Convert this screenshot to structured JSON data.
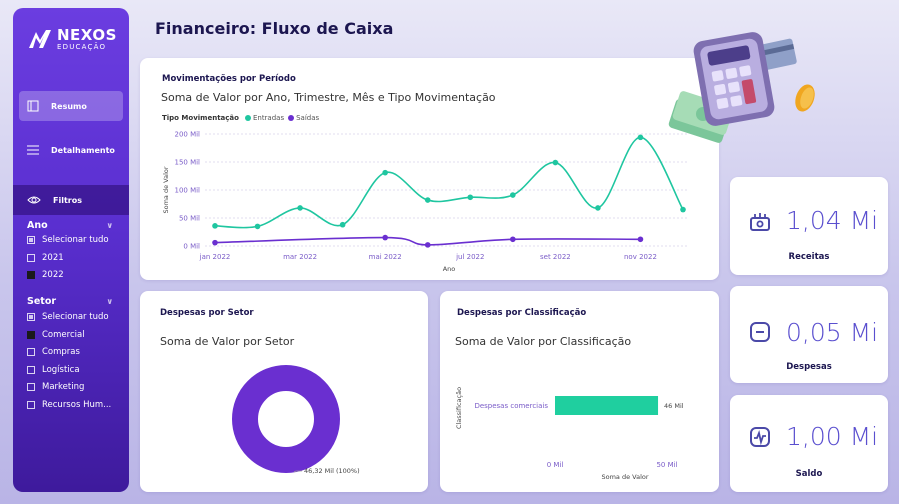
{
  "brand": {
    "name": "NEXOS",
    "tagline": "EDUCAÇÃO"
  },
  "sidebar": {
    "nav": [
      {
        "label": "Resumo",
        "icon": "page-icon",
        "active": true
      },
      {
        "label": "Detalhamento",
        "icon": "menu-icon",
        "active": false
      }
    ],
    "filters_label": "Filtros",
    "slicers": {
      "ano": {
        "title": "Ano",
        "options": [
          {
            "label": "Selecionar tudo",
            "state": "partial"
          },
          {
            "label": "2021",
            "state": "unchecked"
          },
          {
            "label": "2022",
            "state": "checked"
          }
        ]
      },
      "setor": {
        "title": "Setor",
        "options": [
          {
            "label": "Selecionar tudo",
            "state": "partial"
          },
          {
            "label": "Comercial",
            "state": "checked"
          },
          {
            "label": "Compras",
            "state": "unchecked"
          },
          {
            "label": "Logística",
            "state": "unchecked"
          },
          {
            "label": "Marketing",
            "state": "unchecked"
          },
          {
            "label": "Recursos Hum...",
            "state": "unchecked"
          }
        ]
      }
    }
  },
  "page": {
    "title": "Financeiro: Fluxo de Caixa"
  },
  "mov": {
    "card_title": "Movimentações por Período",
    "subtitle": "Soma de Valor por Ano, Trimestre, Mês e Tipo Movimentação",
    "legend_title": "Tipo Movimentação",
    "legend": [
      {
        "name": "Entradas",
        "color": "#1fc6a0"
      },
      {
        "name": "Saídas",
        "color": "#6a2fd0"
      }
    ],
    "ylabel": "Soma de Valor",
    "xlabel": "Ano"
  },
  "chart_data": [
    {
      "type": "line",
      "title": "Soma de Valor por Ano, Trimestre, Mês e Tipo Movimentação",
      "xlabel": "Ano",
      "ylabel": "Soma de Valor",
      "x": [
        "jan 2022",
        "fev 2022",
        "mar 2022",
        "abr 2022",
        "mai 2022",
        "jun 2022",
        "jul 2022",
        "ago 2022",
        "set 2022",
        "out 2022",
        "nov 2022",
        "dez 2022"
      ],
      "x_ticks": [
        "jan 2022",
        "mar 2022",
        "mai 2022",
        "jul 2022",
        "set 2022",
        "nov 2022"
      ],
      "y_ticks": [
        "0 Mil",
        "50 Mil",
        "100 Mil",
        "150 Mil",
        "200 Mil"
      ],
      "ylim": [
        0,
        200
      ],
      "series": [
        {
          "name": "Entradas",
          "color": "#1fc6a0",
          "values": [
            36,
            35,
            68,
            38,
            131,
            82,
            87,
            91,
            149,
            68,
            194,
            65
          ]
        },
        {
          "name": "Saídas",
          "color": "#6a2fd0",
          "values": [
            6,
            null,
            null,
            null,
            15,
            2,
            null,
            12,
            null,
            null,
            12,
            null
          ]
        }
      ]
    },
    {
      "type": "pie",
      "title": "Soma de Valor por Setor",
      "slices": [
        {
          "name": "Comercial",
          "value": 46.32,
          "label": "46,32 Mil (100%)",
          "color": "#6a2fd0"
        }
      ]
    },
    {
      "type": "bar",
      "orientation": "horizontal",
      "title": "Soma de Valor por Classificação",
      "ylabel": "Classificação",
      "xlabel": "Soma de Valor",
      "categories": [
        "Despesas comerciais"
      ],
      "values": [
        46
      ],
      "value_labels": [
        "46 Mil"
      ],
      "x_ticks": [
        "0 Mil",
        "50 Mil"
      ],
      "xlim": [
        0,
        50
      ],
      "color": "#1fcf9f"
    }
  ],
  "setor": {
    "card_title": "Despesas por Setor",
    "subtitle": "Soma de Valor por Setor",
    "slice_label": "46,32 Mil (100%)"
  },
  "classif": {
    "card_title": "Despesas por Classificação",
    "subtitle": "Soma de Valor por Classificação",
    "ylabel": "Classificação",
    "xlabel": "Soma de Valor",
    "category": "Despesas comerciais",
    "value_label": "46 Mil",
    "tick0": "0 Mil",
    "tick1": "50 Mil"
  },
  "kpis": [
    {
      "value": "1,04 Mi",
      "label": "Receitas",
      "icon": "wallet-icon"
    },
    {
      "value": "0,05 Mi",
      "label": "Despesas",
      "icon": "minus-icon"
    },
    {
      "value": "1,00 Mi",
      "label": "Saldo",
      "icon": "pulse-icon"
    }
  ],
  "colors": {
    "accent": "#5a4fcf",
    "entradas": "#1fc6a0",
    "saidas": "#6a2fd0",
    "sidebar": "#5a2fd0"
  }
}
